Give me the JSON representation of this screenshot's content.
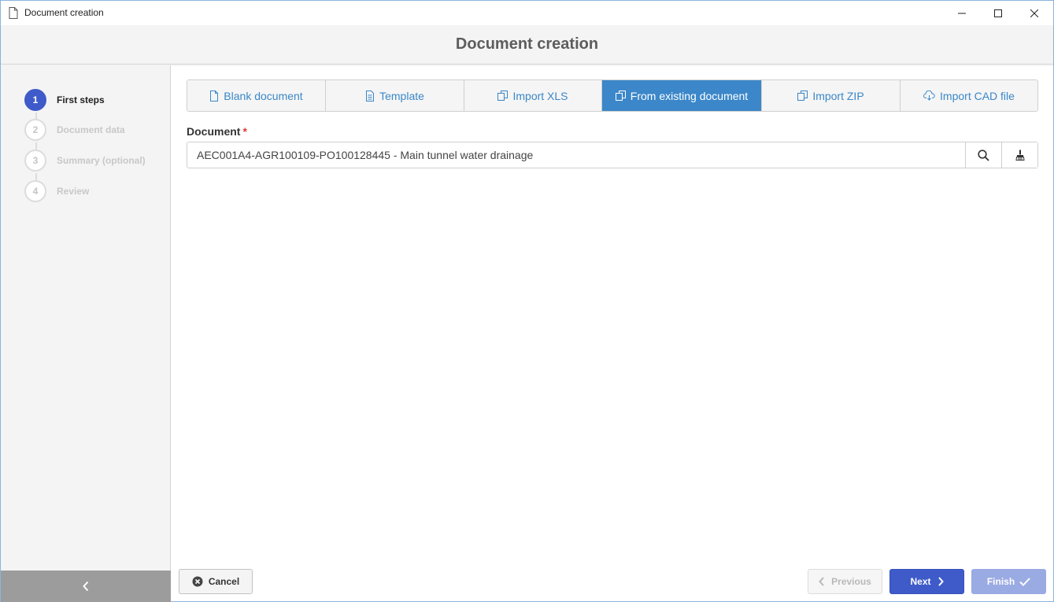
{
  "window": {
    "title": "Document creation"
  },
  "header": {
    "title": "Document creation"
  },
  "steps": [
    {
      "number": "1",
      "label": "First steps",
      "active": true
    },
    {
      "number": "2",
      "label": "Document data",
      "active": false
    },
    {
      "number": "3",
      "label": "Summary (optional)",
      "active": false
    },
    {
      "number": "4",
      "label": "Review",
      "active": false
    }
  ],
  "tabs": [
    {
      "label": "Blank document",
      "icon": "file-icon"
    },
    {
      "label": "Template",
      "icon": "file-text-icon"
    },
    {
      "label": "Import XLS",
      "icon": "copy-icon"
    },
    {
      "label": "From existing document",
      "icon": "copy-icon",
      "active": true
    },
    {
      "label": "Import ZIP",
      "icon": "copy-icon"
    },
    {
      "label": "Import CAD file",
      "icon": "cloud-download-icon"
    }
  ],
  "document_field": {
    "label": "Document",
    "required_mark": "*",
    "value": "AEC001A4-AGR100109-PO100128445 - Main tunnel water drainage"
  },
  "footer": {
    "cancel_label": "Cancel",
    "previous_label": "Previous",
    "next_label": "Next",
    "finish_label": "Finish"
  },
  "colors": {
    "accent": "#3f5bc9",
    "tab_active": "#3b87c9",
    "tab_text": "#3a87c8",
    "required": "#e03a3a"
  }
}
